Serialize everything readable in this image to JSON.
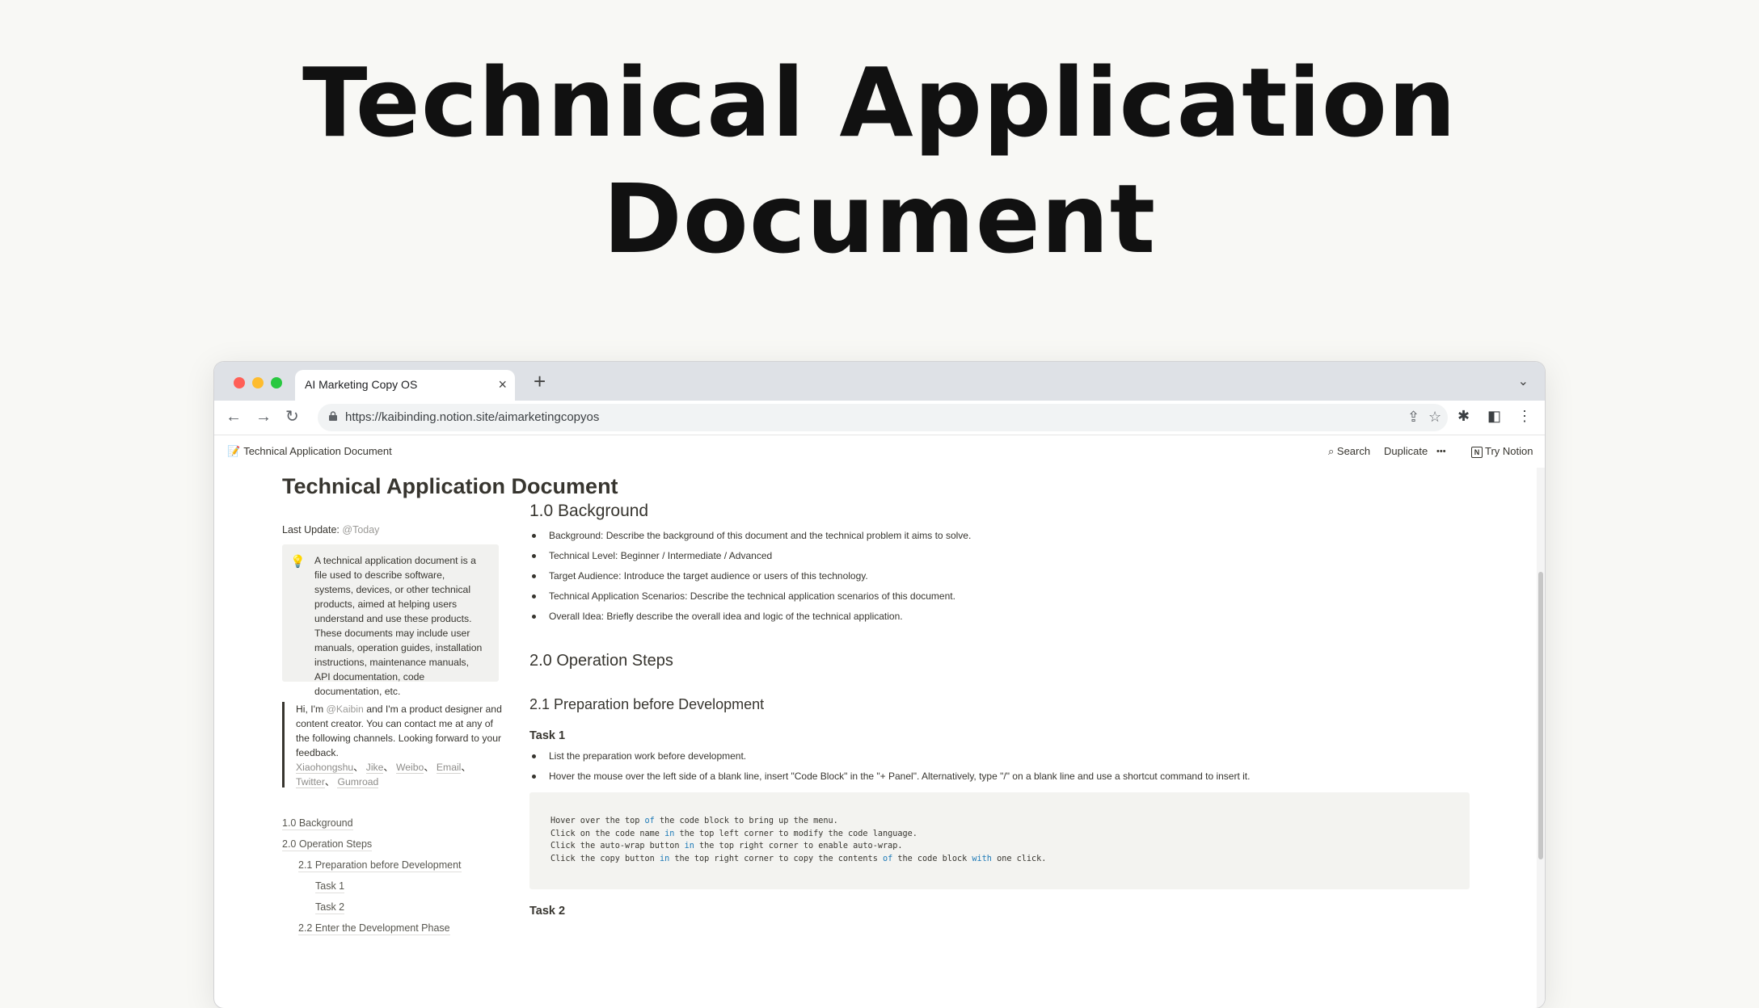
{
  "hero": {
    "line1": "Technical Application",
    "line2": "Document"
  },
  "browser": {
    "tab_title": "AI Marketing Copy OS",
    "tab_close": "×",
    "new_tab": "+",
    "url": "https://kaibinding.notion.site/aimarketingcopyos"
  },
  "notion": {
    "breadcrumb_icon": "📝",
    "breadcrumb": "Technical Application Document",
    "search_label": "Search",
    "duplicate_label": "Duplicate",
    "more_label": "•••",
    "try_notion_label": "Try Notion"
  },
  "page": {
    "title": "Technical Application Document",
    "last_update_label": "Last Update:",
    "last_update_value": "@Today",
    "callout_text": "A technical application document is a file used to describe software, systems, devices, or other technical products, aimed at helping users understand and use these products. These documents may include user manuals, operation guides, installation instructions, maintenance manuals, API documentation, code documentation, etc.",
    "quote": {
      "pre": "Hi, I'm ",
      "mention": "@Kaibin",
      "post": " and I'm a product designer and content creator. You can contact me at any of the following channels. Looking forward to your feedback.",
      "links": [
        "Xiaohongshu",
        "Jike",
        "Weibo",
        "Email",
        "Twitter",
        "Gumroad"
      ]
    },
    "toc": [
      "1.0 Background",
      "2.0 Operation Steps",
      "2.1 Preparation before Development",
      "Task 1",
      "Task 2",
      "2.2 Enter the Development Phase"
    ]
  },
  "main": {
    "h_background": "1.0 Background",
    "background_items": [
      "Background: Describe the background of this document and the technical problem it aims to solve.",
      "Technical Level: Beginner / Intermediate / Advanced",
      "Target Audience: Introduce the target audience or users of this technology.",
      "Technical Application Scenarios: Describe the technical application scenarios of this document.",
      "Overall Idea: Briefly describe the overall idea and logic of the technical application."
    ],
    "h_operation": "2.0 Operation Steps",
    "h_preparation": "2.1 Preparation before Development",
    "task1": "Task 1",
    "task1_items": [
      "List the preparation work before development.",
      "Hover the mouse over the left side of a blank line, insert \"Code Block\" in the \"+ Panel\". Alternatively, type \"/\" on a blank line and use a shortcut command to insert it."
    ],
    "code_lines": [
      "Hover over the top of the code block to bring up the menu.",
      "Click on the code name in the top left corner to modify the code language.",
      "Click the auto-wrap button in the top right corner to enable auto-wrap.",
      "Click the copy button in the top right corner to copy the contents of the code block with one click."
    ],
    "task2": "Task 2"
  }
}
